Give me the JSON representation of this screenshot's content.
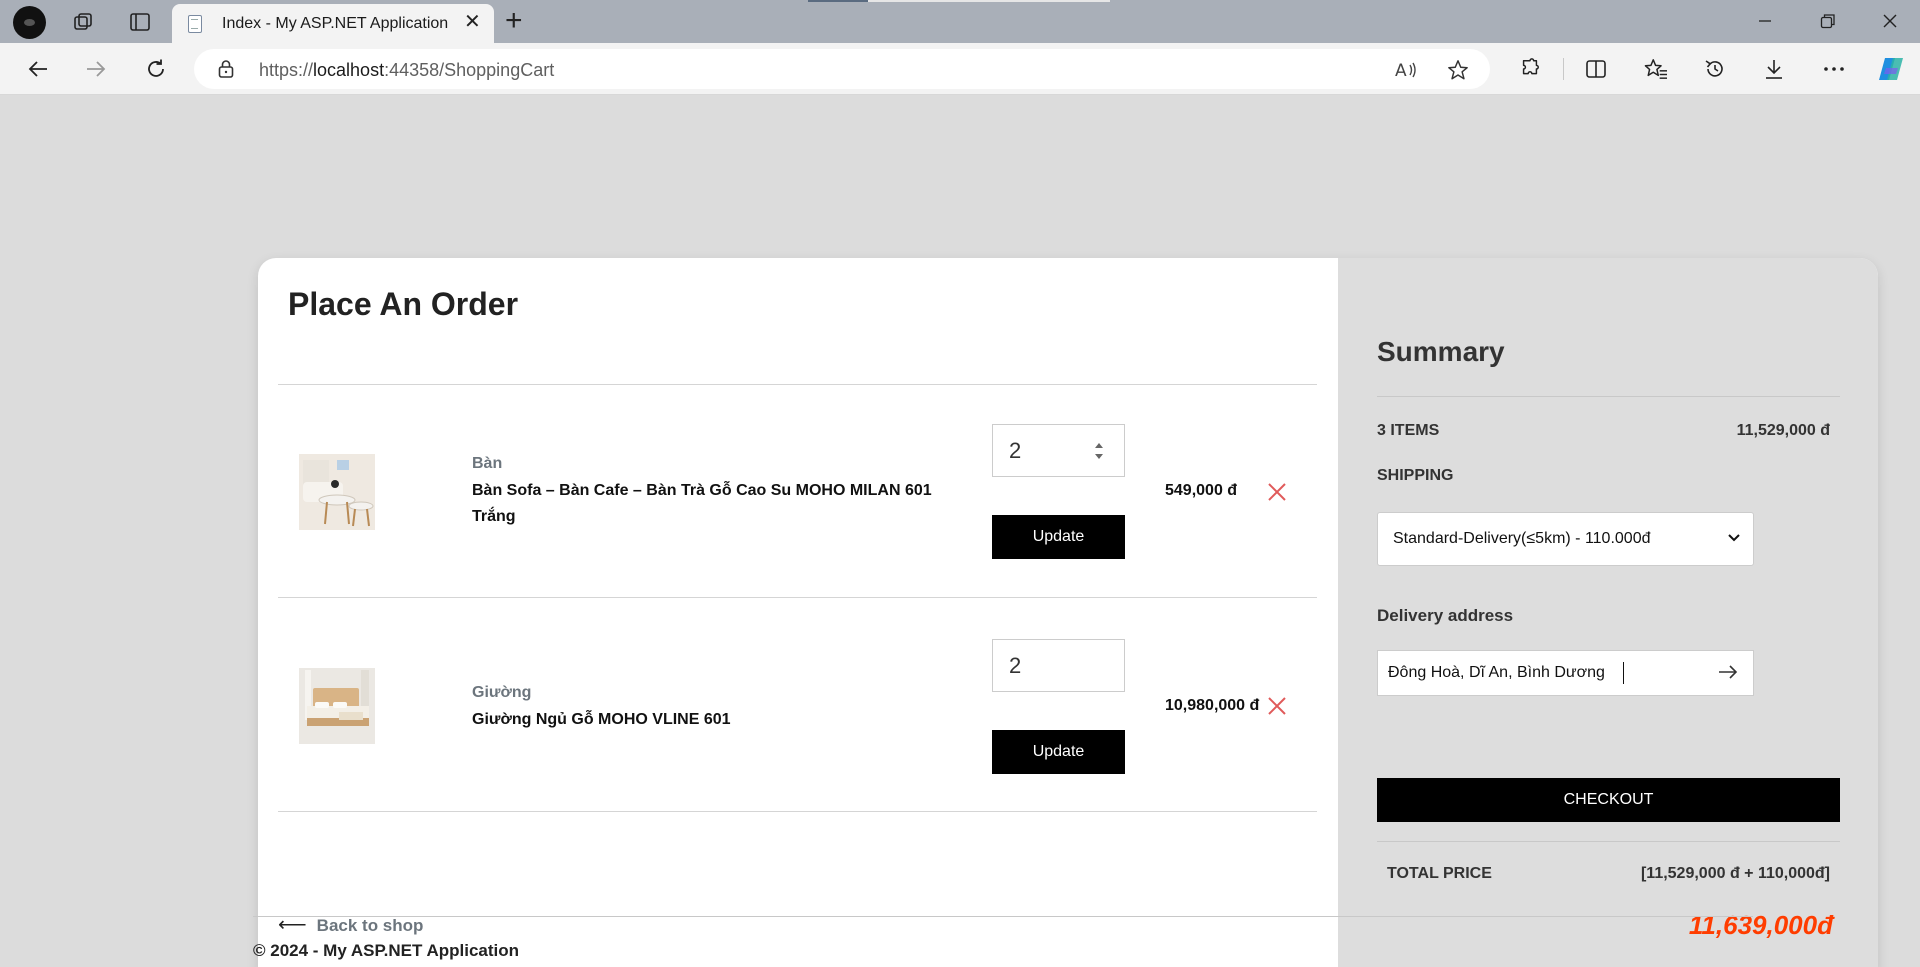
{
  "browser": {
    "tab_title": "Index - My ASP.NET Application",
    "url_prefix": "https://",
    "url_host": "localhost",
    "url_path": ":44358/ShoppingCart",
    "icons": [
      "profile-icon",
      "workspaces-icon",
      "tab-actions-icon",
      "back-icon",
      "forward-icon",
      "refresh-icon",
      "lock-icon",
      "read-aloud-icon",
      "favorite-star-icon",
      "extensions-icon",
      "split-screen-icon",
      "favorites-icon",
      "history-icon",
      "downloads-icon",
      "more-icon",
      "copilot-icon"
    ]
  },
  "order": {
    "title": "Place An Order",
    "items": [
      {
        "category": "Bàn",
        "name": "Bàn Sofa – Bàn Cafe – Bàn Trà Gỗ Cao Su MOHO MILAN 601 Trắng",
        "quantity": "2",
        "update_label": "Update",
        "price": "549,000 đ"
      },
      {
        "category": "Giường",
        "name": "Giường Ngủ Gỗ MOHO VLINE 601",
        "quantity": "2",
        "update_label": "Update",
        "price": "10,980,000 đ"
      }
    ],
    "back_label": "Back to shop"
  },
  "summary": {
    "title": "Summary",
    "items_label": "3 ITEMS",
    "items_total": "11,529,000 đ",
    "shipping_label": "SHIPPING",
    "shipping_selected": "Standard-Delivery(≤5km) - 110.000đ",
    "address_label": "Delivery address",
    "address_value": "Đông Hoà, Dĩ An, Bình Dương",
    "checkout_label": "CHECKOUT",
    "total_label": "TOTAL PRICE",
    "total_breakdown": "[11,529,000 đ + 110,000đ]",
    "total_value": "11,639,000đ"
  },
  "footer": {
    "text": "© 2024 - My ASP.NET Application"
  },
  "colors": {
    "accent_total": "#ff3d00",
    "remove_x": "#e05a5a",
    "button_bg": "#000000"
  }
}
